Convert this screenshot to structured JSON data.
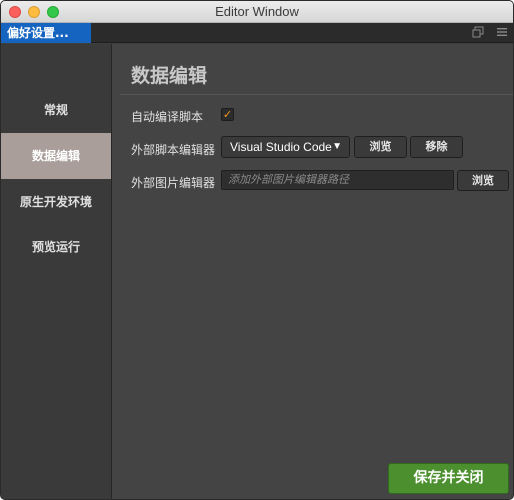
{
  "window": {
    "title": "Editor Window"
  },
  "tab": {
    "label": "偏好设置..."
  },
  "tab_icons": {
    "popout": "popout-icon",
    "menu": "hamburger-menu-icon"
  },
  "sidebar": {
    "items": [
      {
        "label": "常规",
        "active": false
      },
      {
        "label": "数据编辑",
        "active": true
      },
      {
        "label": "原生开发环境",
        "active": false
      },
      {
        "label": "预览运行",
        "active": false
      }
    ]
  },
  "main": {
    "title": "数据编辑",
    "auto_compile": {
      "label": "自动编译脚本",
      "checked": true
    },
    "script_editor": {
      "label": "外部脚本编辑器",
      "selected": "Visual Studio Code",
      "browse_label": "浏览",
      "remove_label": "移除"
    },
    "image_editor": {
      "label": "外部图片编辑器",
      "placeholder": "添加外部图片编辑器路径",
      "browse_label": "浏览"
    },
    "save_close_label": "保存并关闭"
  },
  "colors": {
    "accent_tab": "#1565c0",
    "active_sidebar": "#a99e9a",
    "save_button": "#4c8f2e",
    "checkmark": "#f59a23"
  }
}
